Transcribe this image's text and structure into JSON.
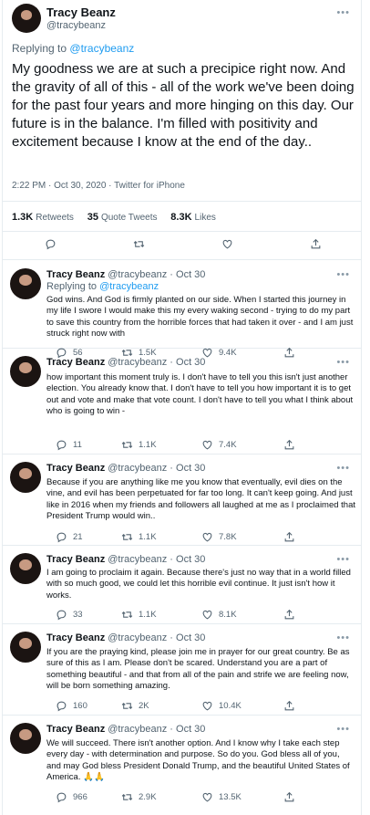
{
  "main_tweet": {
    "author_name": "Tracy Beanz",
    "author_handle": "@tracybeanz",
    "replying_prefix": "Replying to",
    "replying_to": "@tracybeanz",
    "text": "My goodness we are at such a precipice right now. And the gravity of all of this - all of the work we've been doing for the past four years and more hinging on this day. Our future is in the balance. I'm filled with positivity and excitement because I know at the end of the day..",
    "timestamp": "2:22 PM · Oct 30, 2020 · Twitter for iPhone",
    "retweets": "1.3K",
    "retweets_label": "Retweets",
    "quote_tweets": "35",
    "quote_tweets_label": "Quote Tweets",
    "likes": "8.3K",
    "likes_label": "Likes"
  },
  "replies": [
    {
      "name": "Tracy Beanz",
      "handle": "@tracybeanz · Oct 30",
      "replying_prefix": "Replying to",
      "replying_to": "@tracybeanz",
      "text": "God wins. And God is firmly planted on our side. When I started this journey in my life I swore I would make this my every waking second - trying to do my part to save this country from the horrible forces that had taken it over - and I am just struck right now with",
      "replies": "56",
      "retweets": "1.5K",
      "likes": "9.4K"
    },
    {
      "name": "Tracy Beanz",
      "handle": "@tracybeanz · Oct 30",
      "text": "how important this moment truly is. I don't have to tell you this isn't just another election. You already know that. I don't have to tell you how important it is to get out and vote and make that vote count. I don't have to tell you what I think about who is going to win -",
      "replies": "11",
      "retweets": "1.1K",
      "likes": "7.4K"
    },
    {
      "name": "Tracy Beanz",
      "handle": "@tracybeanz · Oct 30",
      "text": "Because if you are anything like me you know that eventually, evil dies on the vine, and evil has been perpetuated for far too long. It can't keep going. And just like in 2016 when my friends and followers all laughed at me as I proclaimed that President Trump would win..",
      "replies": "21",
      "retweets": "1.1K",
      "likes": "7.8K"
    },
    {
      "name": "Tracy Beanz",
      "handle": "@tracybeanz · Oct 30",
      "text": "I am going to proclaim it again. Because there's just no way that in a world filled with so much good, we could let this horrible evil continue. It just isn't how it works.",
      "replies": "33",
      "retweets": "1.1K",
      "likes": "8.1K"
    },
    {
      "name": "Tracy Beanz",
      "handle": "@tracybeanz · Oct 30",
      "text": "If you are the praying kind, please join me in prayer for our great country. Be as sure of this as I am. Please don't be scared. Understand you are a part of something beautiful - and that from all of the pain and strife we are feeling now, will be born something amazing.",
      "replies": "160",
      "retweets": "2K",
      "likes": "10.4K"
    },
    {
      "name": "Tracy Beanz",
      "handle": "@tracybeanz · Oct 30",
      "text": "We will succeed. There isn't another option. And I know why I take each step every day - with determination and purpose. So do you. God bless all of you, and may God bless President Donald Trump, and the beautiful United States of America. 🙏🙏",
      "replies": "966",
      "retweets": "2.9K",
      "likes": "13.5K"
    }
  ],
  "icons": {
    "reply": "reply-icon",
    "retweet": "retweet-icon",
    "like": "heart-icon",
    "share": "share-icon",
    "more": "more-icon"
  },
  "colors": {
    "link": "#1d9bf0",
    "secondary_text": "#536471",
    "divider": "#e6ecf0"
  }
}
